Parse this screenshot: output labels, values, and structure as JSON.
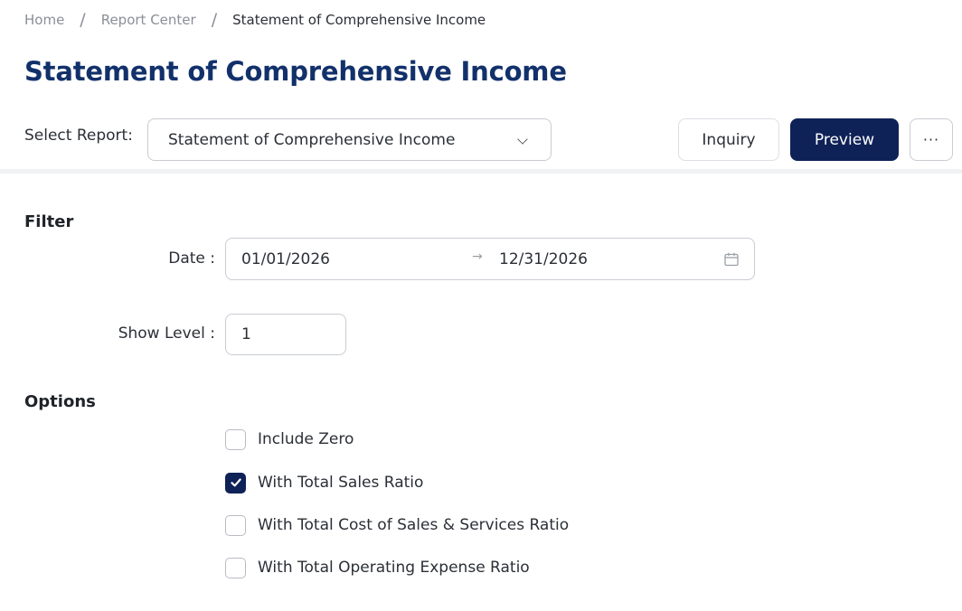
{
  "breadcrumb": {
    "items": [
      "Home",
      "Report Center",
      "Statement of Comprehensive Income"
    ],
    "separator": "/"
  },
  "page": {
    "title": "Statement of Comprehensive Income"
  },
  "report_bar": {
    "select_label": "Select Report:",
    "selected_report": "Statement of Comprehensive Income",
    "inquiry_label": "Inquiry",
    "preview_label": "Preview",
    "more_label": "···"
  },
  "filter": {
    "heading": "Filter",
    "date_label": "Date :",
    "date_start": "01/01/2026",
    "date_end": "12/31/2026",
    "range_arrow": "→",
    "show_level_label": "Show Level :",
    "show_level_value": "1"
  },
  "options": {
    "heading": "Options",
    "items": [
      {
        "label": "Include Zero",
        "checked": false
      },
      {
        "label": "With Total Sales Ratio",
        "checked": true
      },
      {
        "label": "With Total Cost of Sales & Services Ratio",
        "checked": false
      },
      {
        "label": "With Total Operating Expense Ratio",
        "checked": false
      }
    ]
  },
  "colors": {
    "title": "#12316b",
    "primary_button": "#0f2257",
    "checked_box": "#0f2257"
  }
}
